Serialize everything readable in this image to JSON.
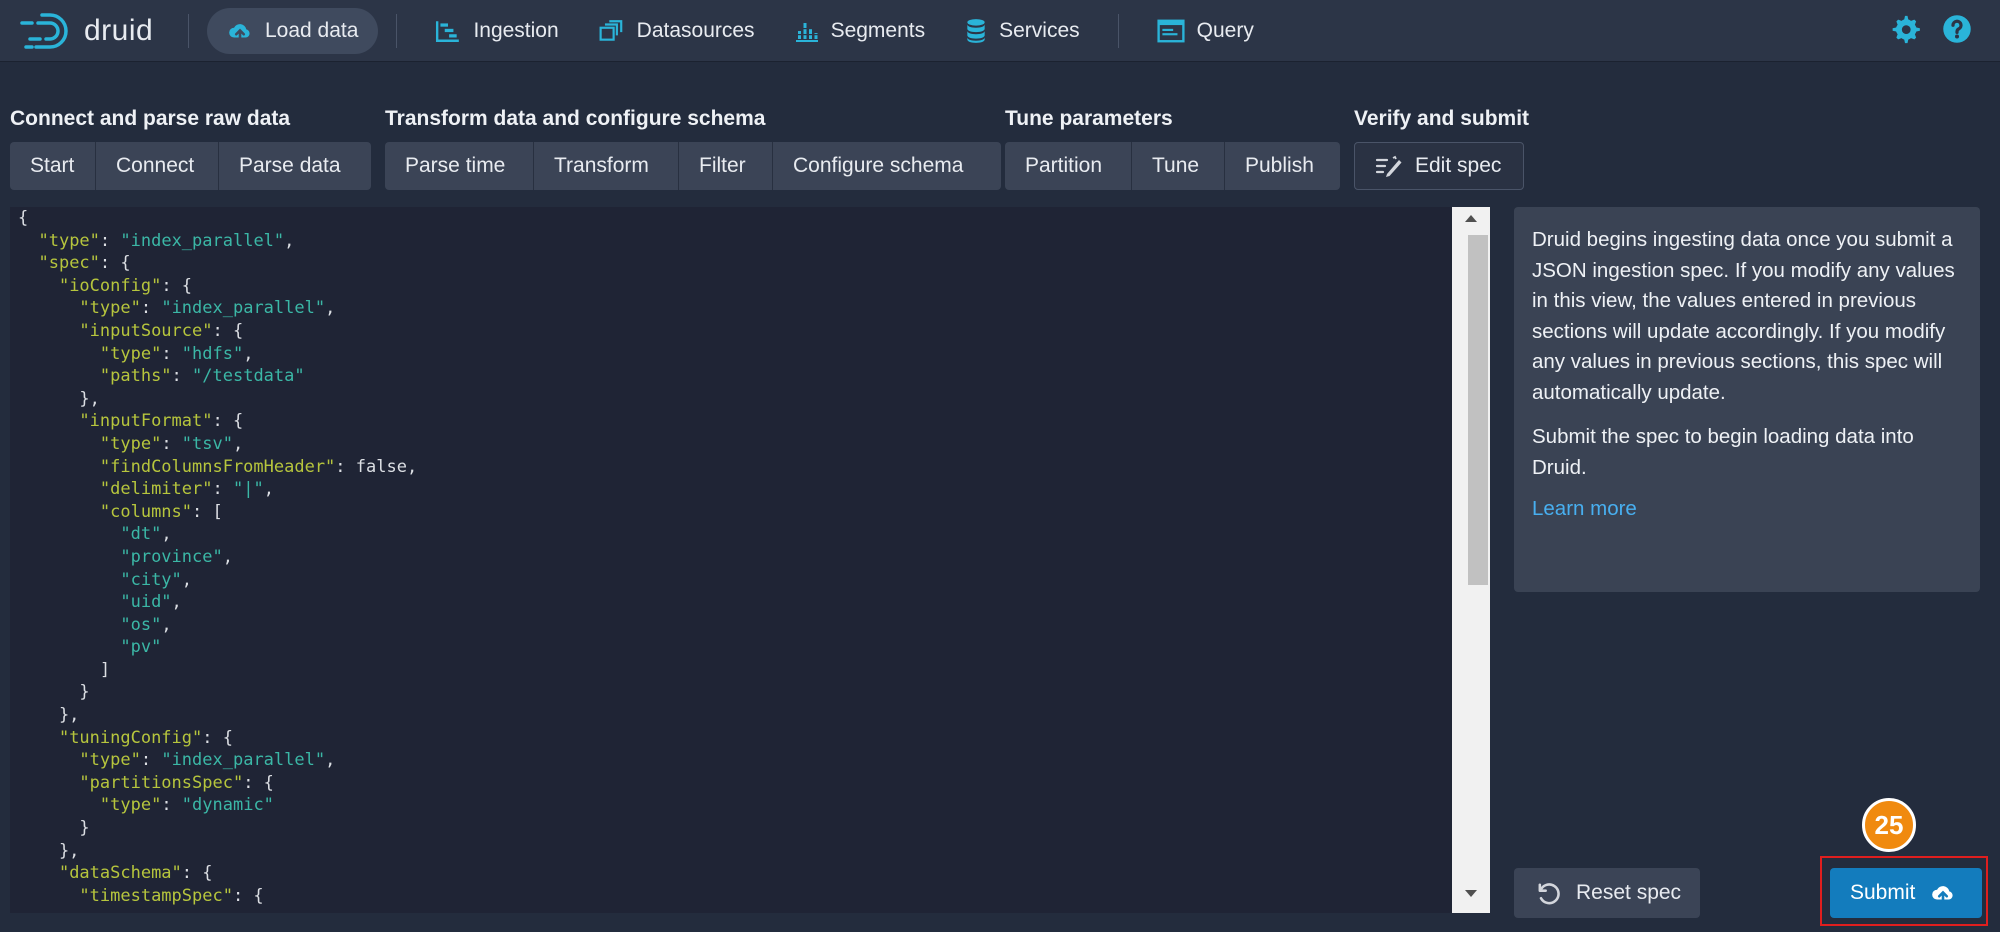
{
  "app": {
    "logo_text": "druid"
  },
  "nav": {
    "items": [
      {
        "label": "Load data",
        "icon": "cloud-upload-icon",
        "active": true
      },
      {
        "label": "Ingestion",
        "icon": "gantt-chart-icon"
      },
      {
        "label": "Datasources",
        "icon": "multi-select-icon"
      },
      {
        "label": "Segments",
        "icon": "stacked-chart-icon"
      },
      {
        "label": "Services",
        "icon": "database-icon"
      },
      {
        "label": "Query",
        "icon": "application-icon"
      }
    ],
    "right_icons": [
      "gear-icon",
      "help-icon"
    ]
  },
  "steps": {
    "groups": [
      {
        "title": "Connect and parse raw data",
        "buttons": [
          "Start",
          "Connect",
          "Parse data"
        ]
      },
      {
        "title": "Transform data and configure schema",
        "buttons": [
          "Parse time",
          "Transform",
          "Filter",
          "Configure schema"
        ]
      },
      {
        "title": "Tune parameters",
        "buttons": [
          "Partition",
          "Tune",
          "Publish"
        ]
      },
      {
        "title": "Verify and submit",
        "buttons": [
          "Edit spec"
        ]
      }
    ],
    "active": "Edit spec"
  },
  "editor": {
    "lines": [
      "{",
      "  \"type\": \"index_parallel\",",
      "  \"spec\": {",
      "    \"ioConfig\": {",
      "      \"type\": \"index_parallel\",",
      "      \"inputSource\": {",
      "        \"type\": \"hdfs\",",
      "        \"paths\": \"/testdata\"",
      "      },",
      "      \"inputFormat\": {",
      "        \"type\": \"tsv\",",
      "        \"findColumnsFromHeader\": false,",
      "        \"delimiter\": \"|\",",
      "        \"columns\": [",
      "          \"dt\",",
      "          \"province\",",
      "          \"city\",",
      "          \"uid\",",
      "          \"os\",",
      "          \"pv\"",
      "        ]",
      "      }",
      "    },",
      "    \"tuningConfig\": {",
      "      \"type\": \"index_parallel\",",
      "      \"partitionsSpec\": {",
      "        \"type\": \"dynamic\"",
      "      }",
      "    },",
      "    \"dataSchema\": {",
      "      \"timestampSpec\": {"
    ]
  },
  "info": {
    "paragraph1": "Druid begins ingesting data once you submit a JSON ingestion spec. If you modify any values in this view, the values entered in previous sections will update accordingly. If you modify any values in previous sections, this spec will automatically update.",
    "paragraph2": "Submit the spec to begin loading data into Druid.",
    "learn_more": "Learn more"
  },
  "actions": {
    "reset_label": "Reset spec",
    "submit_label": "Submit",
    "badge": "25"
  },
  "colors": {
    "accent": "#137cbd",
    "nav_icon": "#2ab4d9",
    "key": "#b6c53d",
    "string": "#3bb7a6",
    "highlight": "#e01e1e",
    "badge": "#f08a0f"
  }
}
